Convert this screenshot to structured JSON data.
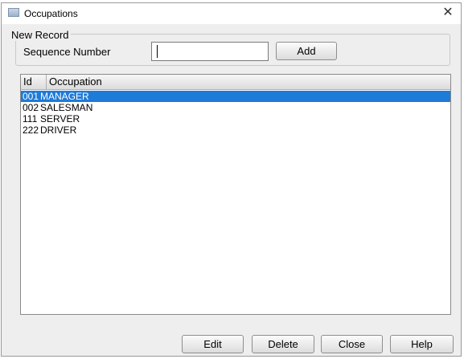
{
  "window": {
    "title": "Occupations",
    "close_glyph": "✕"
  },
  "new_record": {
    "legend": "New Record",
    "sequence_label": "Sequence Number",
    "sequence_value": "",
    "add_label": "Add"
  },
  "list": {
    "columns": [
      "Id",
      "Occupation"
    ],
    "rows": [
      {
        "id": "001",
        "occupation": "MANAGER",
        "selected": true
      },
      {
        "id": "002",
        "occupation": "SALESMAN",
        "selected": false
      },
      {
        "id": "111",
        "occupation": "SERVER",
        "selected": false
      },
      {
        "id": "222",
        "occupation": "DRIVER",
        "selected": false
      }
    ]
  },
  "buttons": {
    "edit": "Edit",
    "delete": "Delete",
    "close": "Close",
    "help": "Help"
  },
  "colors": {
    "selection": "#1e7bd7",
    "window_bg": "#eeeeee"
  }
}
